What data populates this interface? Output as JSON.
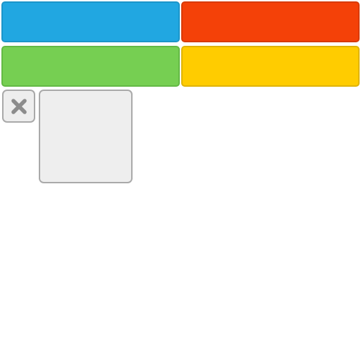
{
  "palette": {
    "buttons": [
      {
        "id": "blue",
        "fill": "#21a7e1",
        "border": "#1b95c9"
      },
      {
        "id": "red",
        "fill": "#f44108",
        "border": "#d83a06"
      },
      {
        "id": "green",
        "fill": "#76cf52",
        "border": "#63b944"
      },
      {
        "id": "yellow",
        "fill": "#ffcc00",
        "border": "#e0b300"
      }
    ]
  },
  "close": {
    "icon": "close-icon",
    "fill": "#eeeeee",
    "border": "#a9a9a9",
    "glyph_color": "#8c8c8c"
  },
  "preview": {
    "fill": "#eeeeee",
    "border": "#a9a9a9"
  }
}
